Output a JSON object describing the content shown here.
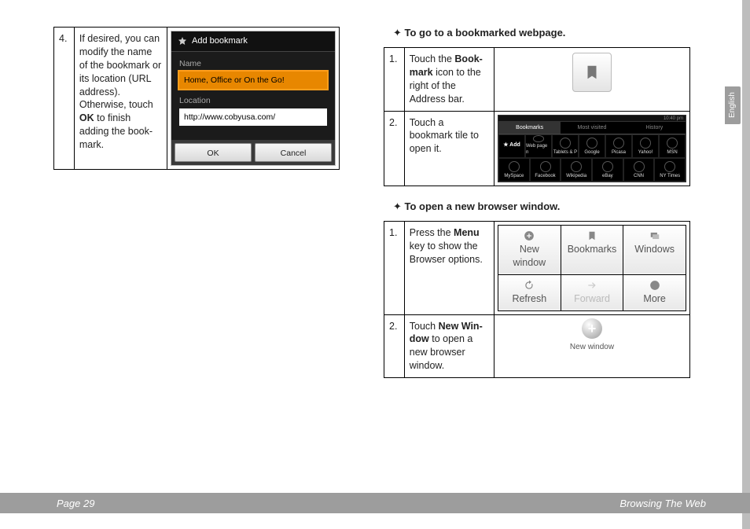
{
  "sideTab": "English",
  "footer": {
    "page": "Page 29",
    "section": "Browsing The Web"
  },
  "left": {
    "step4": {
      "num": "4.",
      "text_a": "If desired, you can modify the name of the bookmark or its location (URL address). Otherwise, touch ",
      "text_b": "OK",
      "text_c": " to finish adding the book-mark."
    },
    "dialog": {
      "title": "Add bookmark",
      "name_label": "Name",
      "name_value": "Home, Office or On the Go!",
      "loc_label": "Location",
      "loc_value": "http://www.cobyusa.com/",
      "ok": "OK",
      "cancel": "Cancel"
    }
  },
  "right": {
    "heading1": "To go to a bookmarked webpage.",
    "t1s1": {
      "num": "1.",
      "a": "Touch the ",
      "b": "Book-mark",
      "c": " icon to the right of the Address bar."
    },
    "t1s2": {
      "num": "2.",
      "txt": "Touch a bookmark tile to open it."
    },
    "grid": {
      "status_time": "10:40 pm",
      "tabs": [
        "Bookmarks",
        "Most visited",
        "History"
      ],
      "add": "★ Add",
      "row1": [
        "Web page n",
        "Tablets & P",
        "Google",
        "Picasa",
        "Yahoo!",
        "MSN"
      ],
      "row2": [
        "MySpace",
        "Facebook",
        "Wikipedia",
        "eBay",
        "CNN",
        "NY Times"
      ]
    },
    "heading2": "To open a new browser window.",
    "t2s1": {
      "num": "1.",
      "a": "Press the ",
      "b": "Menu",
      "c": " key to show the Browser options."
    },
    "t2s2": {
      "num": "2.",
      "a": "Touch ",
      "b": "New Win-dow",
      "c": " to open a new browser window."
    },
    "menu": {
      "items": [
        "New window",
        "Bookmarks",
        "Windows",
        "Refresh",
        "Forward",
        "More"
      ],
      "disabled_index": 4
    },
    "newWindow": {
      "label": "New window"
    }
  }
}
